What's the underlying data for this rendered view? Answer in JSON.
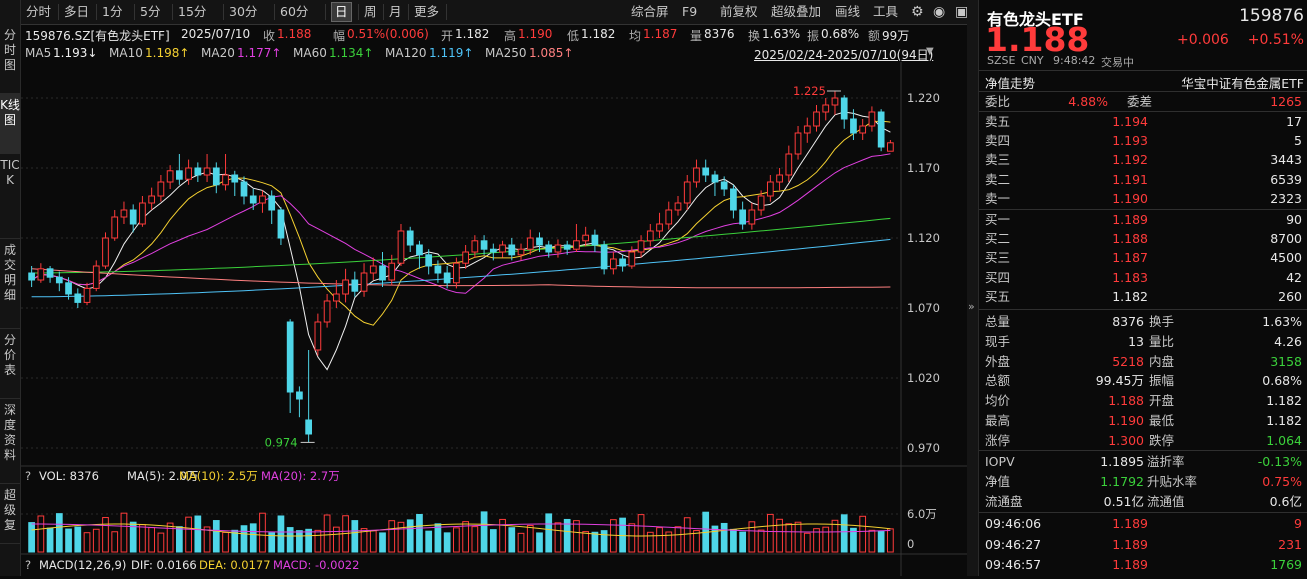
{
  "leftbar": {
    "tabs": [
      "分时图",
      "K线图",
      "TICK",
      "成交明细",
      "分价表",
      "深度资料",
      "超级复"
    ]
  },
  "toolbar": {
    "periods": [
      "分时",
      "多日",
      "1分",
      "5分",
      "15分",
      "30分",
      "60分",
      "日",
      "周",
      "月",
      "更多"
    ],
    "active_period": "日",
    "actions": [
      "综合屏",
      "F9",
      "前复权",
      "超级叠加",
      "画线",
      "工具"
    ],
    "icons": [
      "gear-icon",
      "eye-icon",
      "wp-icon"
    ]
  },
  "info": {
    "code": "159876.SZ[有色龙头ETF]",
    "date": "2025/07/10",
    "close_label": "收",
    "close": "1.188",
    "chg_label": "幅",
    "chg": "0.51%(0.006)",
    "open_label": "开",
    "open": "1.182",
    "high_label": "高",
    "high": "1.190",
    "low_label": "低",
    "low": "1.182",
    "avg_label": "均",
    "avg": "1.187",
    "vol_label": "量",
    "vol": "8376",
    "turn_label": "换",
    "turn": "1.63%",
    "amp_label": "振",
    "amp": "0.68%",
    "amt_label": "额",
    "amt": "99万"
  },
  "ma_line": {
    "items": [
      {
        "label": "MA5",
        "value": "1.193↓",
        "color": "#f0f0f0"
      },
      {
        "label": "MA10",
        "value": "1.198↑",
        "color": "#f5d131"
      },
      {
        "label": "MA20",
        "value": "1.177↑",
        "color": "#e040e0"
      },
      {
        "label": "MA60",
        "value": "1.134↑",
        "color": "#3bd13b"
      },
      {
        "label": "MA120",
        "value": "1.119↑",
        "color": "#4fc3f7"
      },
      {
        "label": "MA250",
        "value": "1.085↑",
        "color": "#ff8080"
      }
    ],
    "range": "2025/02/24-2025/07/10(94日)"
  },
  "chart_data": {
    "type": "candlestick",
    "price_axis": {
      "ticks": [
        "1.220",
        "1.170",
        "1.120",
        "1.070",
        "1.020",
        "0.970"
      ],
      "ylim": [
        0.96,
        1.24
      ]
    },
    "high_label": "1.225",
    "low_label": "0.974",
    "candles": [
      [
        1.095,
        1.09,
        1.1,
        1.085
      ],
      [
        1.09,
        1.098,
        1.102,
        1.088
      ],
      [
        1.098,
        1.092,
        1.1,
        1.088
      ],
      [
        1.092,
        1.088,
        1.096,
        1.082
      ],
      [
        1.088,
        1.08,
        1.092,
        1.076
      ],
      [
        1.08,
        1.074,
        1.084,
        1.07
      ],
      [
        1.074,
        1.084,
        1.088,
        1.072
      ],
      [
        1.084,
        1.1,
        1.104,
        1.082
      ],
      [
        1.1,
        1.12,
        1.124,
        1.098
      ],
      [
        1.12,
        1.135,
        1.14,
        1.118
      ],
      [
        1.135,
        1.14,
        1.146,
        1.13
      ],
      [
        1.14,
        1.13,
        1.144,
        1.124
      ],
      [
        1.13,
        1.145,
        1.15,
        1.128
      ],
      [
        1.145,
        1.15,
        1.156,
        1.14
      ],
      [
        1.15,
        1.16,
        1.165,
        1.146
      ],
      [
        1.16,
        1.168,
        1.172,
        1.155
      ],
      [
        1.168,
        1.162,
        1.18,
        1.158
      ],
      [
        1.162,
        1.17,
        1.176,
        1.158
      ],
      [
        1.17,
        1.165,
        1.174,
        1.16
      ],
      [
        1.165,
        1.17,
        1.18,
        1.16
      ],
      [
        1.17,
        1.158,
        1.174,
        1.152
      ],
      [
        1.158,
        1.165,
        1.18,
        1.154
      ],
      [
        1.165,
        1.16,
        1.168,
        1.15
      ],
      [
        1.16,
        1.15,
        1.164,
        1.144
      ],
      [
        1.15,
        1.145,
        1.155,
        1.14
      ],
      [
        1.145,
        1.15,
        1.154,
        1.138
      ],
      [
        1.15,
        1.14,
        1.154,
        1.13
      ],
      [
        1.14,
        1.12,
        1.142,
        1.115
      ],
      [
        1.06,
        1.01,
        1.062,
        0.995
      ],
      [
        1.01,
        1.005,
        1.014,
        0.992
      ],
      [
        0.99,
        0.98,
        1.04,
        0.974
      ],
      [
        1.04,
        1.06,
        1.066,
        1.036
      ],
      [
        1.06,
        1.075,
        1.08,
        1.056
      ],
      [
        1.075,
        1.08,
        1.09,
        1.07
      ],
      [
        1.08,
        1.09,
        1.098,
        1.074
      ],
      [
        1.09,
        1.082,
        1.096,
        1.078
      ],
      [
        1.082,
        1.095,
        1.102,
        1.078
      ],
      [
        1.095,
        1.1,
        1.106,
        1.09
      ],
      [
        1.1,
        1.09,
        1.11,
        1.085
      ],
      [
        1.09,
        1.102,
        1.108,
        1.086
      ],
      [
        1.102,
        1.125,
        1.13,
        1.1
      ],
      [
        1.125,
        1.115,
        1.128,
        1.11
      ],
      [
        1.115,
        1.108,
        1.118,
        1.098
      ],
      [
        1.108,
        1.1,
        1.112,
        1.094
      ],
      [
        1.1,
        1.095,
        1.104,
        1.088
      ],
      [
        1.095,
        1.088,
        1.1,
        1.084
      ],
      [
        1.088,
        1.102,
        1.106,
        1.084
      ],
      [
        1.102,
        1.11,
        1.115,
        1.098
      ],
      [
        1.11,
        1.118,
        1.122,
        1.106
      ],
      [
        1.118,
        1.112,
        1.122,
        1.108
      ],
      [
        1.112,
        1.11,
        1.116,
        1.104
      ],
      [
        1.11,
        1.115,
        1.118,
        1.106
      ],
      [
        1.115,
        1.108,
        1.12,
        1.104
      ],
      [
        1.108,
        1.112,
        1.116,
        1.104
      ],
      [
        1.112,
        1.12,
        1.126,
        1.108
      ],
      [
        1.12,
        1.115,
        1.124,
        1.11
      ],
      [
        1.115,
        1.11,
        1.118,
        1.106
      ],
      [
        1.11,
        1.115,
        1.119,
        1.106
      ],
      [
        1.115,
        1.112,
        1.118,
        1.108
      ],
      [
        1.112,
        1.118,
        1.13,
        1.11
      ],
      [
        1.118,
        1.122,
        1.128,
        1.114
      ],
      [
        1.122,
        1.115,
        1.126,
        1.11
      ],
      [
        1.115,
        1.098,
        1.118,
        1.094
      ],
      [
        1.098,
        1.105,
        1.11,
        1.094
      ],
      [
        1.105,
        1.1,
        1.108,
        1.096
      ],
      [
        1.1,
        1.11,
        1.114,
        1.098
      ],
      [
        1.11,
        1.118,
        1.122,
        1.106
      ],
      [
        1.118,
        1.125,
        1.13,
        1.114
      ],
      [
        1.125,
        1.13,
        1.138,
        1.12
      ],
      [
        1.13,
        1.14,
        1.146,
        1.126
      ],
      [
        1.14,
        1.145,
        1.15,
        1.136
      ],
      [
        1.145,
        1.16,
        1.165,
        1.14
      ],
      [
        1.16,
        1.17,
        1.176,
        1.156
      ],
      [
        1.17,
        1.165,
        1.176,
        1.16
      ],
      [
        1.165,
        1.16,
        1.168,
        1.15
      ],
      [
        1.16,
        1.155,
        1.164,
        1.15
      ],
      [
        1.155,
        1.14,
        1.158,
        1.134
      ],
      [
        1.14,
        1.13,
        1.146,
        1.126
      ],
      [
        1.13,
        1.14,
        1.145,
        1.126
      ],
      [
        1.14,
        1.15,
        1.154,
        1.136
      ],
      [
        1.15,
        1.16,
        1.165,
        1.146
      ],
      [
        1.16,
        1.165,
        1.17,
        1.154
      ],
      [
        1.165,
        1.18,
        1.186,
        1.16
      ],
      [
        1.18,
        1.195,
        1.2,
        1.176
      ],
      [
        1.195,
        1.2,
        1.206,
        1.188
      ],
      [
        1.2,
        1.21,
        1.215,
        1.196
      ],
      [
        1.21,
        1.215,
        1.22,
        1.204
      ],
      [
        1.215,
        1.22,
        1.225,
        1.208
      ],
      [
        1.22,
        1.205,
        1.222,
        1.198
      ],
      [
        1.205,
        1.195,
        1.212,
        1.19
      ],
      [
        1.195,
        1.2,
        1.205,
        1.19
      ],
      [
        1.2,
        1.21,
        1.214,
        1.196
      ],
      [
        1.21,
        1.185,
        1.212,
        1.182
      ],
      [
        1.182,
        1.188,
        1.19,
        1.182
      ]
    ]
  },
  "vol_panel": {
    "label": "VOL: 8376",
    "ma5": "MA(5): 2.0万",
    "ma10": "MA(10): 2.5万",
    "ma20": "MA(20): 2.7万",
    "ticks": [
      "6.0万",
      "0"
    ]
  },
  "macd_panel": {
    "label": "MACD(12,26,9)",
    "dif": "DIF: 0.0166",
    "dea": "DEA: 0.0177",
    "macd": "MACD: -0.0022"
  },
  "quote": {
    "name": "有色龙头ETF",
    "code": "159876",
    "price": "1.188",
    "change": "+0.006",
    "pct": "+0.51%",
    "exch": "SZSE",
    "cur": "CNY",
    "time": "9:48:42",
    "status": "交易中",
    "nav_label": "净值走势",
    "index_name": "华宝中证有色金属ETF",
    "wb_label": "委比",
    "wb": "4.88%",
    "wc_label": "委差",
    "wc": "1265",
    "asks": [
      [
        "卖五",
        "1.194",
        "17"
      ],
      [
        "卖四",
        "1.193",
        "5"
      ],
      [
        "卖三",
        "1.192",
        "3443"
      ],
      [
        "卖二",
        "1.191",
        "6539"
      ],
      [
        "卖一",
        "1.190",
        "2323"
      ]
    ],
    "bids": [
      [
        "买一",
        "1.189",
        "90"
      ],
      [
        "买二",
        "1.188",
        "8700"
      ],
      [
        "买三",
        "1.187",
        "4500"
      ],
      [
        "买四",
        "1.183",
        "42"
      ],
      [
        "买五",
        "1.182",
        "260"
      ]
    ],
    "stats": [
      [
        "总量",
        "8376",
        "white",
        "换手",
        "1.63%",
        "white"
      ],
      [
        "现手",
        "13",
        "white",
        "量比",
        "4.26",
        "white"
      ],
      [
        "外盘",
        "5218",
        "red",
        "内盘",
        "3158",
        "green"
      ],
      [
        "总额",
        "99.45万",
        "white",
        "振幅",
        "0.68%",
        "white"
      ],
      [
        "均价",
        "1.188",
        "red",
        "开盘",
        "1.182",
        "white"
      ],
      [
        "最高",
        "1.190",
        "red",
        "最低",
        "1.182",
        "white"
      ],
      [
        "涨停",
        "1.300",
        "red",
        "跌停",
        "1.064",
        "green"
      ]
    ],
    "extra": [
      [
        "IOPV",
        "1.1895",
        "white",
        "溢折率",
        "-0.13%",
        "green"
      ],
      [
        "净值",
        "1.1792",
        "green",
        "升贴水率",
        "0.75%",
        "red"
      ],
      [
        "流通盘",
        "0.51亿",
        "white",
        "流通值",
        "0.6亿",
        "white"
      ]
    ],
    "ticks": [
      [
        "09:46:06",
        "1.189",
        "9",
        "red"
      ],
      [
        "09:46:27",
        "1.189",
        "231",
        "red"
      ],
      [
        "09:46:57",
        "1.189",
        "1769",
        "green"
      ]
    ]
  }
}
